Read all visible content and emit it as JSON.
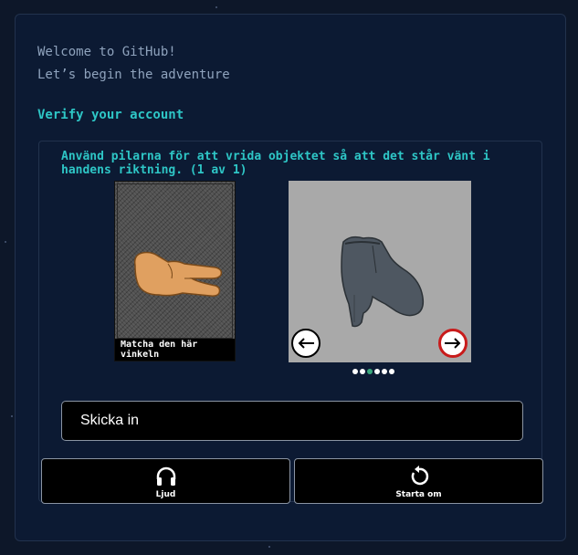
{
  "header": {
    "welcome": "Welcome to GitHub!",
    "subtitle": "Let’s begin the adventure"
  },
  "verify": {
    "title": "Verify your account"
  },
  "challenge": {
    "instructions": "Använd pilarna för att vrida objektet så att det står vänt i handens riktning. (1 av 1)",
    "reference_caption": "Matcha den här vinkeln",
    "reference_icon": "pointing-hand",
    "object_icon": "ankle-boot",
    "progress": {
      "total": 6,
      "active_index": 2
    }
  },
  "buttons": {
    "submit_label": "Skicka in",
    "audio_label": "Ljud",
    "restart_label": "Starta om"
  },
  "colors": {
    "accent": "#2ec6c6",
    "background": "#0d1729",
    "card": "#0c1a33",
    "active_dot": "#3aa87c",
    "arrow_ring": "#c81b1b"
  }
}
